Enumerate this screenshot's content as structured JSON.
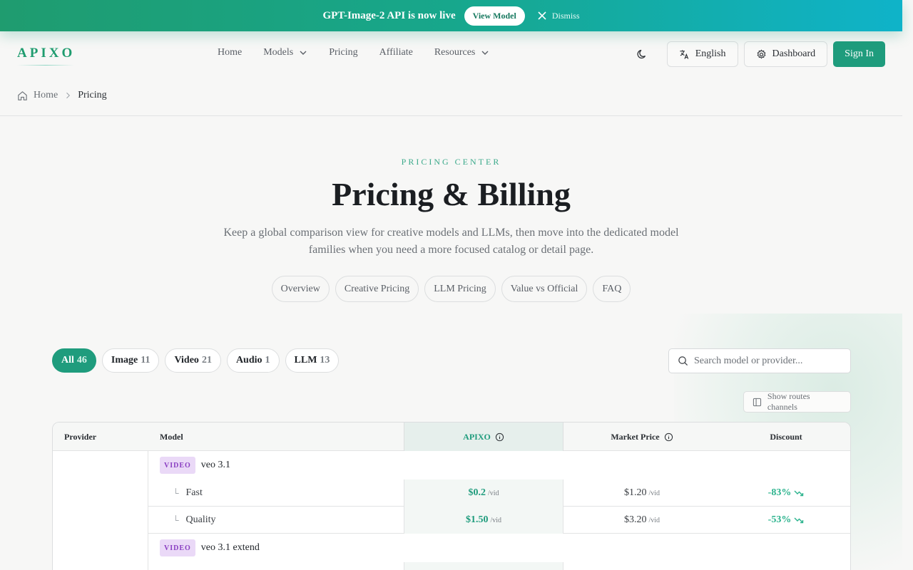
{
  "banner": {
    "text": "GPT-Image-2 API is now live",
    "button": "View Model",
    "dismiss": "Dismiss"
  },
  "header": {
    "logo": "APIXO",
    "nav": [
      {
        "label": "Home"
      },
      {
        "label": "Models",
        "dropdown": true
      },
      {
        "label": "Pricing"
      },
      {
        "label": "Affiliate"
      },
      {
        "label": "Resources",
        "dropdown": true
      }
    ],
    "language_button": "English",
    "dashboard_button": "Dashboard",
    "signin_button": "Sign In"
  },
  "breadcrumb": {
    "home": "Home",
    "current": "Pricing"
  },
  "hero": {
    "eyebrow": "PRICING CENTER",
    "title": "Pricing & Billing",
    "subtitle": "Keep a global comparison view for creative models and LLMs, then move into the dedicated model families when you need a more focused catalog or detail page.",
    "sections": [
      "Overview",
      "Creative Pricing",
      "LLM Pricing",
      "Value vs Official",
      "FAQ"
    ]
  },
  "filters": [
    {
      "label": "All",
      "count": "46",
      "active": true
    },
    {
      "label": "Image",
      "count": "11"
    },
    {
      "label": "Video",
      "count": "21"
    },
    {
      "label": "Audio",
      "count": "1"
    },
    {
      "label": "LLM",
      "count": "13"
    }
  ],
  "search": {
    "placeholder": "Search model or provider..."
  },
  "routes_button": "Show routes channels",
  "table": {
    "headers": {
      "provider": "Provider",
      "model": "Model",
      "apixo": "APIXO",
      "market": "Market Price",
      "discount": "Discount"
    },
    "groups": [
      {
        "badge": "VIDEO",
        "model": "veo 3.1",
        "rows": [
          {
            "tree": "└",
            "name": "Fast",
            "apixo": "$0.2",
            "apixo_unit": "/vid",
            "market": "$1.20",
            "market_unit": "/vid",
            "discount": "-83%"
          },
          {
            "tree": "└",
            "name": "Quality",
            "apixo": "$1.50",
            "apixo_unit": "/vid",
            "market": "$3.20",
            "market_unit": "/vid",
            "discount": "-53%"
          }
        ]
      },
      {
        "badge": "VIDEO",
        "model": "veo 3.1 extend",
        "rows": []
      }
    ]
  },
  "colors": {
    "accent": "#1f9c7d",
    "banner_start": "#1f9c6f",
    "banner_end": "#0fb3c9",
    "video_badge_bg": "#ead9f7",
    "video_badge_text": "#8a3fc2",
    "discount": "#2bb38d"
  },
  "icons": {
    "dismiss": "close-icon",
    "dropdown": "chevron-down-icon",
    "theme": "moon-icon",
    "language": "translate-icon",
    "dashboard": "gear-icon",
    "breadcrumb_home": "home-icon",
    "search": "search-icon",
    "routes": "columns-icon",
    "info": "info-icon",
    "discount_trend": "trending-down-icon"
  }
}
